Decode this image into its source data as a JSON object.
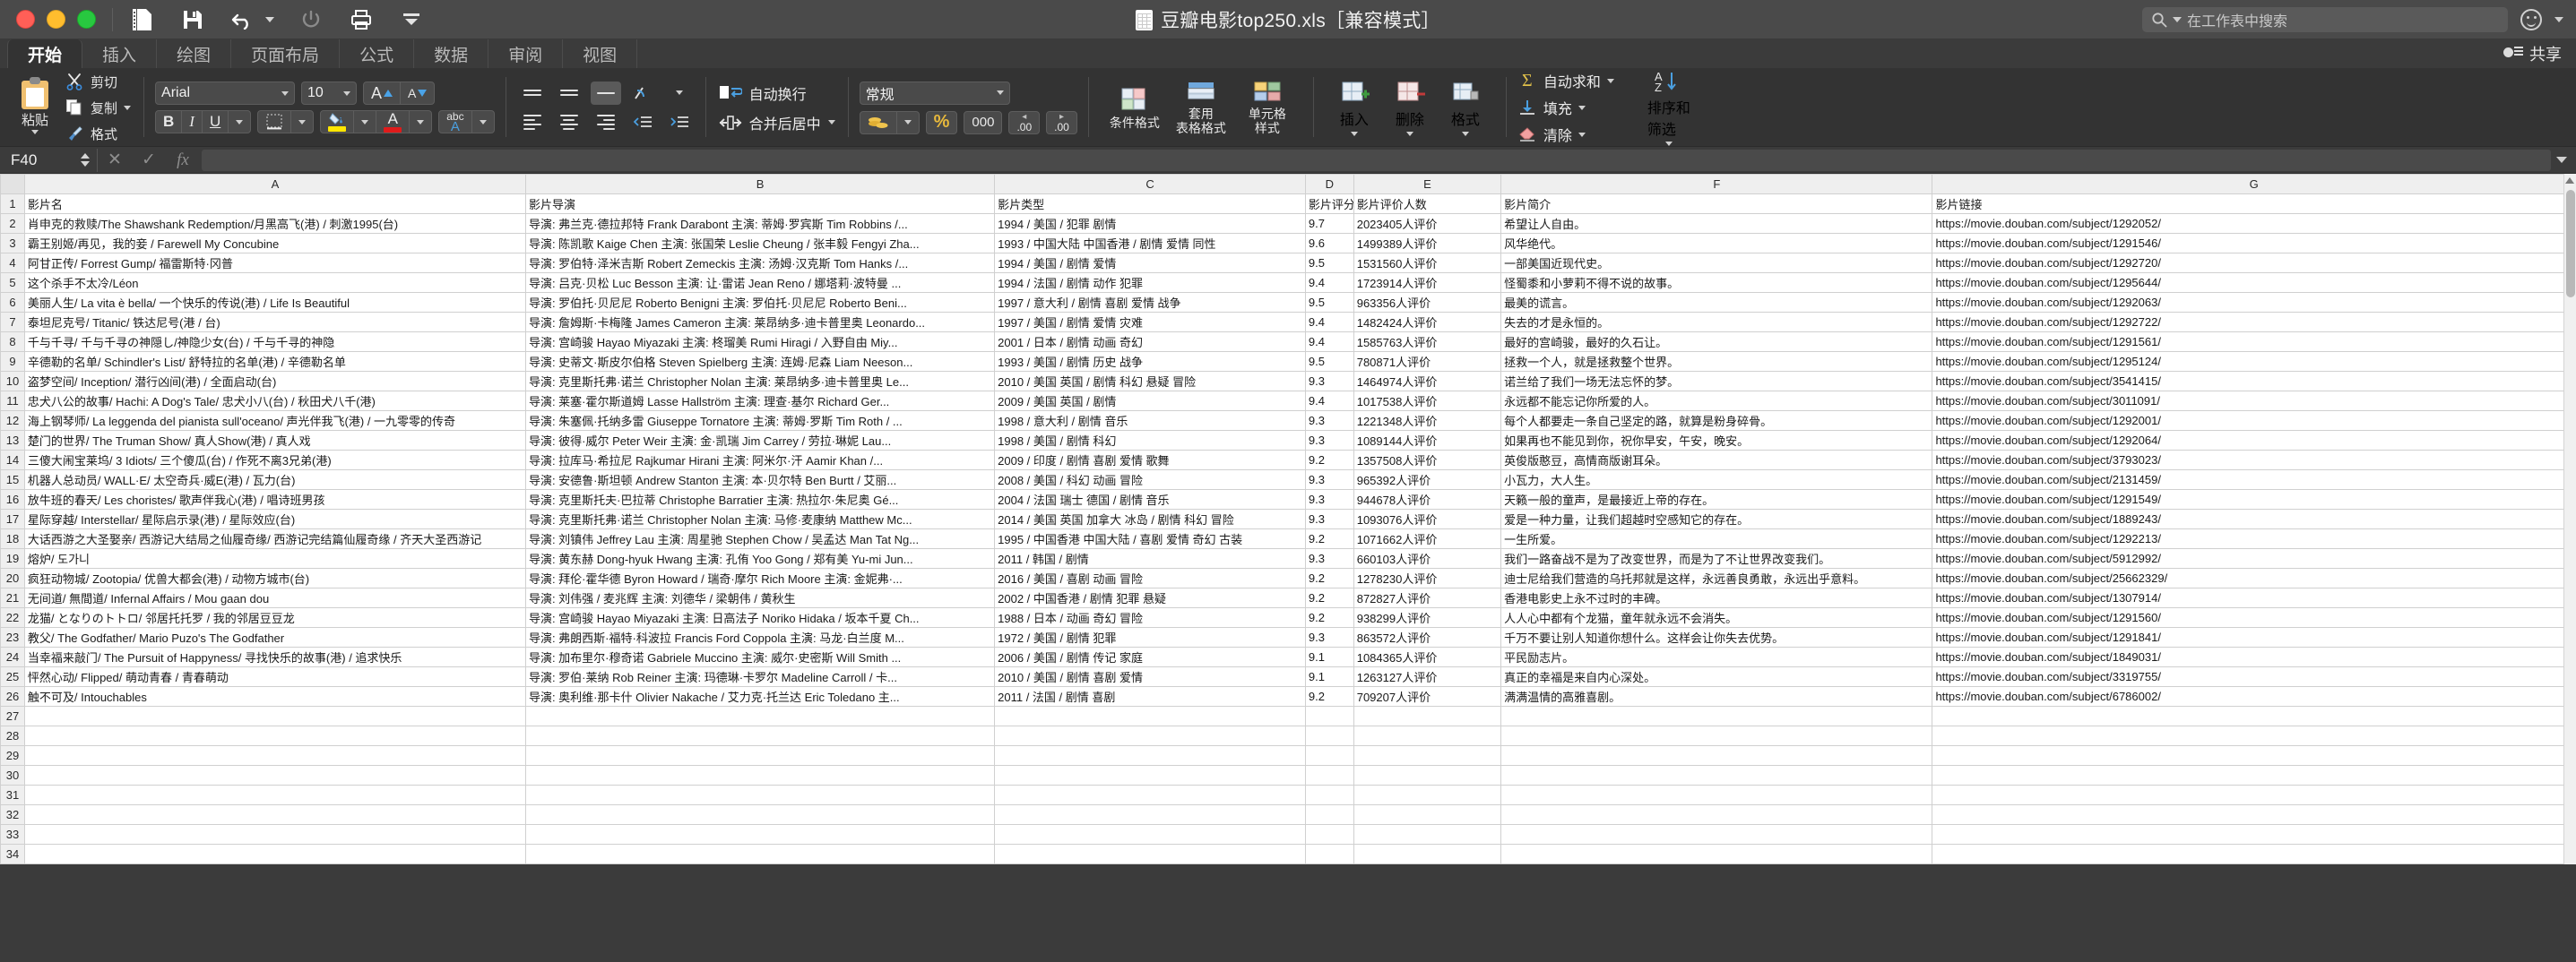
{
  "window": {
    "title": "豆瓣电影top250.xls［兼容模式］",
    "traffic": [
      "close",
      "minimize",
      "maximize"
    ]
  },
  "quick_access": [
    {
      "name": "new-from-template-icon",
      "label": "新建"
    },
    {
      "name": "save-icon",
      "label": "保存"
    },
    {
      "name": "undo-icon",
      "label": "撤消"
    },
    {
      "name": "redo-icon",
      "label": "恢复"
    },
    {
      "name": "print-icon",
      "label": "打印"
    },
    {
      "name": "customize-toolbar-icon",
      "label": "自定义快速访问工具栏"
    }
  ],
  "search": {
    "placeholder": "在工作表中搜索",
    "icon": "search-icon"
  },
  "tabs": [
    {
      "label": "开始",
      "active": true
    },
    {
      "label": "插入",
      "active": false
    },
    {
      "label": "绘图",
      "active": false
    },
    {
      "label": "页面布局",
      "active": false
    },
    {
      "label": "公式",
      "active": false
    },
    {
      "label": "数据",
      "active": false
    },
    {
      "label": "审阅",
      "active": false
    },
    {
      "label": "视图",
      "active": false
    }
  ],
  "share_label": "共享",
  "ribbon": {
    "clipboard": {
      "paste_label": "粘贴",
      "cut_label": "剪切",
      "copy_label": "复制",
      "format_painter_label": "格式"
    },
    "font": {
      "font_family": "Arial",
      "font_size": "10",
      "bold": "B",
      "italic": "I",
      "underline": "U",
      "grow_font": "A",
      "shrink_font": "A",
      "highlight_color": "#ffe600",
      "font_color": "#e01b1b",
      "phonetic_label": "abc",
      "borders": "borders"
    },
    "alignment": {
      "wrap_text_label": "自动换行",
      "merge_center_label": "合并后居中"
    },
    "number": {
      "format": "常规",
      "accounting": "货币",
      "percent": "%",
      "comma": "000",
      "increase_decimal": ".00",
      "decrease_decimal": ".00"
    },
    "styles": [
      {
        "label": "条件格式",
        "name": "conditional-formatting"
      },
      {
        "label": "套用\n表格格式",
        "label_line1": "套用",
        "label_line2": "表格格式",
        "name": "format-as-table"
      },
      {
        "label_line1": "单元格",
        "label_line2": "样式",
        "name": "cell-styles"
      }
    ],
    "cells": [
      {
        "label": "插入",
        "name": "insert-cells"
      },
      {
        "label": "删除",
        "name": "delete-cells"
      },
      {
        "label": "格式",
        "name": "format-cells"
      }
    ],
    "editing": [
      {
        "label": "自动求和",
        "name": "autosum"
      },
      {
        "label": "填充",
        "name": "fill"
      },
      {
        "label": "清除",
        "name": "clear"
      }
    ],
    "sort_filter": {
      "line1": "排序和",
      "line2": "筛选"
    }
  },
  "formula_bar": {
    "name_box": "F40",
    "cancel": "✕",
    "confirm": "✓",
    "fx": "fx",
    "value": ""
  },
  "grid": {
    "columns": [
      "A",
      "B",
      "C",
      "D",
      "E",
      "F",
      "G"
    ],
    "header_row": [
      "影片名",
      "影片导演",
      "影片类型",
      "影片评分",
      "影片评价人数",
      "影片简介",
      "影片链接"
    ],
    "rows": [
      {
        "n": "2",
        "cells": [
          "肖申克的救赎/The Shawshank Redemption/月黑高飞(港) / 刺激1995(台)",
          "导演: 弗兰克·德拉邦特 Frank Darabont   主演: 蒂姆·罗宾斯 Tim Robbins /...",
          "1994 / 美国 / 犯罪 剧情",
          "9.7",
          "2023405人评价",
          "希望让人自由。",
          "https://movie.douban.com/subject/1292052/"
        ]
      },
      {
        "n": "3",
        "cells": [
          "霸王别姬/再见，我的妾 / Farewell My Concubine",
          "导演: 陈凯歌 Kaige Chen   主演: 张国荣 Leslie Cheung / 张丰毅 Fengyi Zha...",
          "1993 / 中国大陆 中国香港 / 剧情 爱情 同性",
          "9.6",
          "1499389人评价",
          "风华绝代。",
          "https://movie.douban.com/subject/1291546/"
        ]
      },
      {
        "n": "4",
        "cells": [
          "阿甘正传/ Forrest Gump/ 福雷斯特·冈普",
          "导演: 罗伯特·泽米吉斯 Robert Zemeckis   主演: 汤姆·汉克斯 Tom Hanks /...",
          "1994 / 美国 / 剧情 爱情",
          "9.5",
          "1531560人评价",
          "一部美国近现代史。",
          "https://movie.douban.com/subject/1292720/"
        ]
      },
      {
        "n": "5",
        "cells": [
          "这个杀手不太冷/Léon",
          "导演: 吕克·贝松 Luc Besson   主演: 让·雷诺 Jean Reno / 娜塔莉·波特曼 ...",
          "1994 / 法国 / 剧情 动作 犯罪",
          "9.4",
          "1723914人评价",
          "怪蜀黍和小萝莉不得不说的故事。",
          "https://movie.douban.com/subject/1295644/"
        ]
      },
      {
        "n": "6",
        "cells": [
          "美丽人生/ La vita è bella/ 一个快乐的传说(港) / Life Is Beautiful",
          "导演: 罗伯托·贝尼尼 Roberto Benigni   主演: 罗伯托·贝尼尼 Roberto Beni...",
          "1997 / 意大利 / 剧情 喜剧 爱情 战争",
          "9.5",
          "963356人评价",
          "最美的谎言。",
          "https://movie.douban.com/subject/1292063/"
        ]
      },
      {
        "n": "7",
        "cells": [
          "泰坦尼克号/ Titanic/ 铁达尼号(港 / 台)",
          "导演: 詹姆斯·卡梅隆 James Cameron   主演: 莱昂纳多·迪卡普里奥 Leonardo...",
          "1997 / 美国 / 剧情 爱情 灾难",
          "9.4",
          "1482424人评价",
          "失去的才是永恒的。",
          "https://movie.douban.com/subject/1292722/"
        ]
      },
      {
        "n": "8",
        "cells": [
          "千与千寻/ 千与千寻の神隠し/神隐少女(台) / 千与千寻的神隐",
          "导演: 宫崎骏 Hayao Miyazaki   主演: 柊瑠美 Rumi Hiragi / 入野自由 Miy...",
          "2001 / 日本 / 剧情 动画 奇幻",
          "9.4",
          "1585763人评价",
          "最好的宫崎骏，最好的久石让。",
          "https://movie.douban.com/subject/1291561/"
        ]
      },
      {
        "n": "9",
        "cells": [
          "辛德勒的名单/ Schindler's List/ 舒特拉的名单(港) / 辛德勒名单",
          "导演: 史蒂文·斯皮尔伯格 Steven Spielberg   主演: 连姆·尼森 Liam Neeson...",
          "1993 / 美国 / 剧情 历史 战争",
          "9.5",
          "780871人评价",
          "拯救一个人，就是拯救整个世界。",
          "https://movie.douban.com/subject/1295124/"
        ]
      },
      {
        "n": "10",
        "cells": [
          "盗梦空间/ Inception/ 潜行凶间(港) / 全面启动(台)",
          "导演: 克里斯托弗·诺兰 Christopher Nolan   主演: 莱昂纳多·迪卡普里奥 Le...",
          "2010 / 美国 英国 / 剧情 科幻 悬疑 冒险",
          "9.3",
          "1464974人评价",
          "诺兰给了我们一场无法忘怀的梦。",
          "https://movie.douban.com/subject/3541415/"
        ]
      },
      {
        "n": "11",
        "cells": [
          "忠犬八公的故事/ Hachi: A Dog's Tale/ 忠犬小八(台) / 秋田犬八千(港)",
          "导演: 莱塞·霍尔斯道姆 Lasse Hallström   主演: 理查·基尔 Richard Ger...",
          "2009 / 美国 英国 / 剧情",
          "9.4",
          "1017538人评价",
          "永远都不能忘记你所爱的人。",
          "https://movie.douban.com/subject/3011091/"
        ]
      },
      {
        "n": "12",
        "cells": [
          "海上钢琴师/ La leggenda del pianista sull'oceano/ 声光伴我飞(港) / 一九零零的传奇",
          "导演: 朱塞佩·托纳多雷 Giuseppe Tornatore   主演: 蒂姆·罗斯 Tim Roth / ...",
          "1998 / 意大利 / 剧情 音乐",
          "9.3",
          "1221348人评价",
          "每个人都要走一条自己坚定的路，就算是粉身碎骨。",
          "https://movie.douban.com/subject/1292001/"
        ]
      },
      {
        "n": "13",
        "cells": [
          "楚门的世界/ The Truman Show/ 真人Show(港) / 真人戏",
          "导演: 彼得·威尔 Peter Weir   主演: 金·凯瑞 Jim Carrey / 劳拉·琳妮 Lau...",
          "1998 / 美国 / 剧情 科幻",
          "9.3",
          "1089144人评价",
          "如果再也不能见到你，祝你早安，午安，晚安。",
          "https://movie.douban.com/subject/1292064/"
        ]
      },
      {
        "n": "14",
        "cells": [
          "三傻大闹宝莱坞/ 3 Idiots/ 三个傻瓜(台) / 作死不离3兄弟(港)",
          "导演: 拉库马·希拉尼 Rajkumar Hirani   主演: 阿米尔·汗 Aamir Khan /...",
          "2009 / 印度 / 剧情 喜剧 爱情 歌舞",
          "9.2",
          "1357508人评价",
          "英俊版憨豆，高情商版谢耳朵。",
          "https://movie.douban.com/subject/3793023/"
        ]
      },
      {
        "n": "15",
        "cells": [
          "机器人总动员/ WALL·E/ 太空奇兵·威E(港) / 瓦力(台)",
          "导演: 安德鲁·斯坦顿 Andrew Stanton   主演: 本·贝尔特 Ben Burtt / 艾丽...",
          "2008 / 美国 / 科幻 动画 冒险",
          "9.3",
          "965392人评价",
          "小瓦力，大人生。",
          "https://movie.douban.com/subject/2131459/"
        ]
      },
      {
        "n": "16",
        "cells": [
          "放牛班的春天/ Les choristes/ 歌声伴我心(港) / 唱诗班男孩",
          "导演: 克里斯托夫·巴拉蒂 Christophe Barratier   主演: 热拉尔·朱尼奥 Gé...",
          "2004 / 法国 瑞士 德国 / 剧情 音乐",
          "9.3",
          "944678人评价",
          "天籁一般的童声，是最接近上帝的存在。",
          "https://movie.douban.com/subject/1291549/"
        ]
      },
      {
        "n": "17",
        "cells": [
          "星际穿越/ Interstellar/ 星际启示录(港) / 星际效应(台)",
          "导演: 克里斯托弗·诺兰 Christopher Nolan   主演: 马修·麦康纳 Matthew Mc...",
          "2014 / 美国 英国 加拿大 冰岛 / 剧情 科幻 冒险",
          "9.3",
          "1093076人评价",
          "爱是一种力量，让我们超越时空感知它的存在。",
          "https://movie.douban.com/subject/1889243/"
        ]
      },
      {
        "n": "18",
        "cells": [
          "大话西游之大圣娶亲/ 西游记大结局之仙履奇缘/ 西游记完结篇仙履奇缘 / 齐天大圣西游记",
          "导演: 刘镇伟 Jeffrey Lau   主演: 周星驰 Stephen Chow / 吴孟达 Man Tat Ng...",
          "1995 / 中国香港 中国大陆 / 喜剧 爱情 奇幻 古装",
          "9.2",
          "1071662人评价",
          "一生所爱。",
          "https://movie.douban.com/subject/1292213/"
        ]
      },
      {
        "n": "19",
        "cells": [
          "熔炉/ 도가니",
          "导演: 黄东赫 Dong-hyuk Hwang   主演: 孔侑 Yoo Gong / 郑有美 Yu-mi Jun...",
          "2011 / 韩国 / 剧情",
          "9.3",
          "660103人评价",
          "我们一路奋战不是为了改变世界，而是为了不让世界改变我们。",
          "https://movie.douban.com/subject/5912992/"
        ]
      },
      {
        "n": "20",
        "cells": [
          "疯狂动物城/ Zootopia/ 优兽大都会(港) / 动物方城市(台)",
          "导演: 拜伦·霍华德 Byron Howard / 瑞奇·摩尔 Rich Moore   主演: 金妮弗·...",
          "2016 / 美国 / 喜剧 动画 冒险",
          "9.2",
          "1278230人评价",
          "迪士尼给我们营造的乌托邦就是这样，永远善良勇敢，永远出乎意料。",
          "https://movie.douban.com/subject/25662329/"
        ]
      },
      {
        "n": "21",
        "cells": [
          "无间道/ 無間道/ Infernal Affairs / Mou gaan dou",
          "导演: 刘伟强 / 麦兆辉   主演: 刘德华 / 梁朝伟 / 黄秋生",
          "2002 / 中国香港 / 剧情 犯罪 悬疑",
          "9.2",
          "872827人评价",
          "香港电影史上永不过时的丰碑。",
          "https://movie.douban.com/subject/1307914/"
        ]
      },
      {
        "n": "22",
        "cells": [
          "龙猫/ となりのトトロ/ 邻居托托罗 / 我的邻居豆豆龙",
          "导演: 宫崎骏 Hayao Miyazaki   主演: 日高法子 Noriko Hidaka / 坂本千夏 Ch...",
          "1988 / 日本 / 动画 奇幻 冒险",
          "9.2",
          "938299人评价",
          "人人心中都有个龙猫，童年就永远不会消失。",
          "https://movie.douban.com/subject/1291560/"
        ]
      },
      {
        "n": "23",
        "cells": [
          "教父/ The Godfather/ Mario Puzo's The Godfather",
          "导演: 弗朗西斯·福特·科波拉 Francis Ford Coppola   主演: 马龙·白兰度 M...",
          "1972 / 美国 / 剧情 犯罪",
          "9.3",
          "863572人评价",
          "千万不要让别人知道你想什么。这样会让你失去优势。",
          "https://movie.douban.com/subject/1291841/"
        ]
      },
      {
        "n": "24",
        "cells": [
          "当幸福来敲门/ The Pursuit of Happyness/ 寻找快乐的故事(港) / 追求快乐",
          "导演: 加布里尔·穆奇诺 Gabriele Muccino   主演: 威尔·史密斯 Will Smith ...",
          "2006 / 美国 / 剧情 传记 家庭",
          "9.1",
          "1084365人评价",
          "平民励志片。",
          "https://movie.douban.com/subject/1849031/"
        ]
      },
      {
        "n": "25",
        "cells": [
          "怦然心动/ Flipped/ 萌动青春 / 青春萌动",
          "导演: 罗伯·莱纳 Rob Reiner   主演: 玛德琳·卡罗尔 Madeline Carroll / 卡...",
          "2010 / 美国 / 剧情 喜剧 爱情",
          "9.1",
          "1263127人评价",
          "真正的幸福是来自内心深处。",
          "https://movie.douban.com/subject/3319755/"
        ]
      },
      {
        "n": "26",
        "cells": [
          "触不可及/ Intouchables",
          "导演: 奥利维·那卡什 Olivier Nakache / 艾力克·托兰达 Eric Toledano   主...",
          "2011 / 法国 / 剧情 喜剧",
          "9.2",
          "709207人评价",
          "满满温情的高雅喜剧。",
          "https://movie.douban.com/subject/6786002/"
        ]
      }
    ],
    "empty_rows": [
      "27",
      "28",
      "29",
      "30",
      "31",
      "32",
      "33",
      "34"
    ]
  }
}
